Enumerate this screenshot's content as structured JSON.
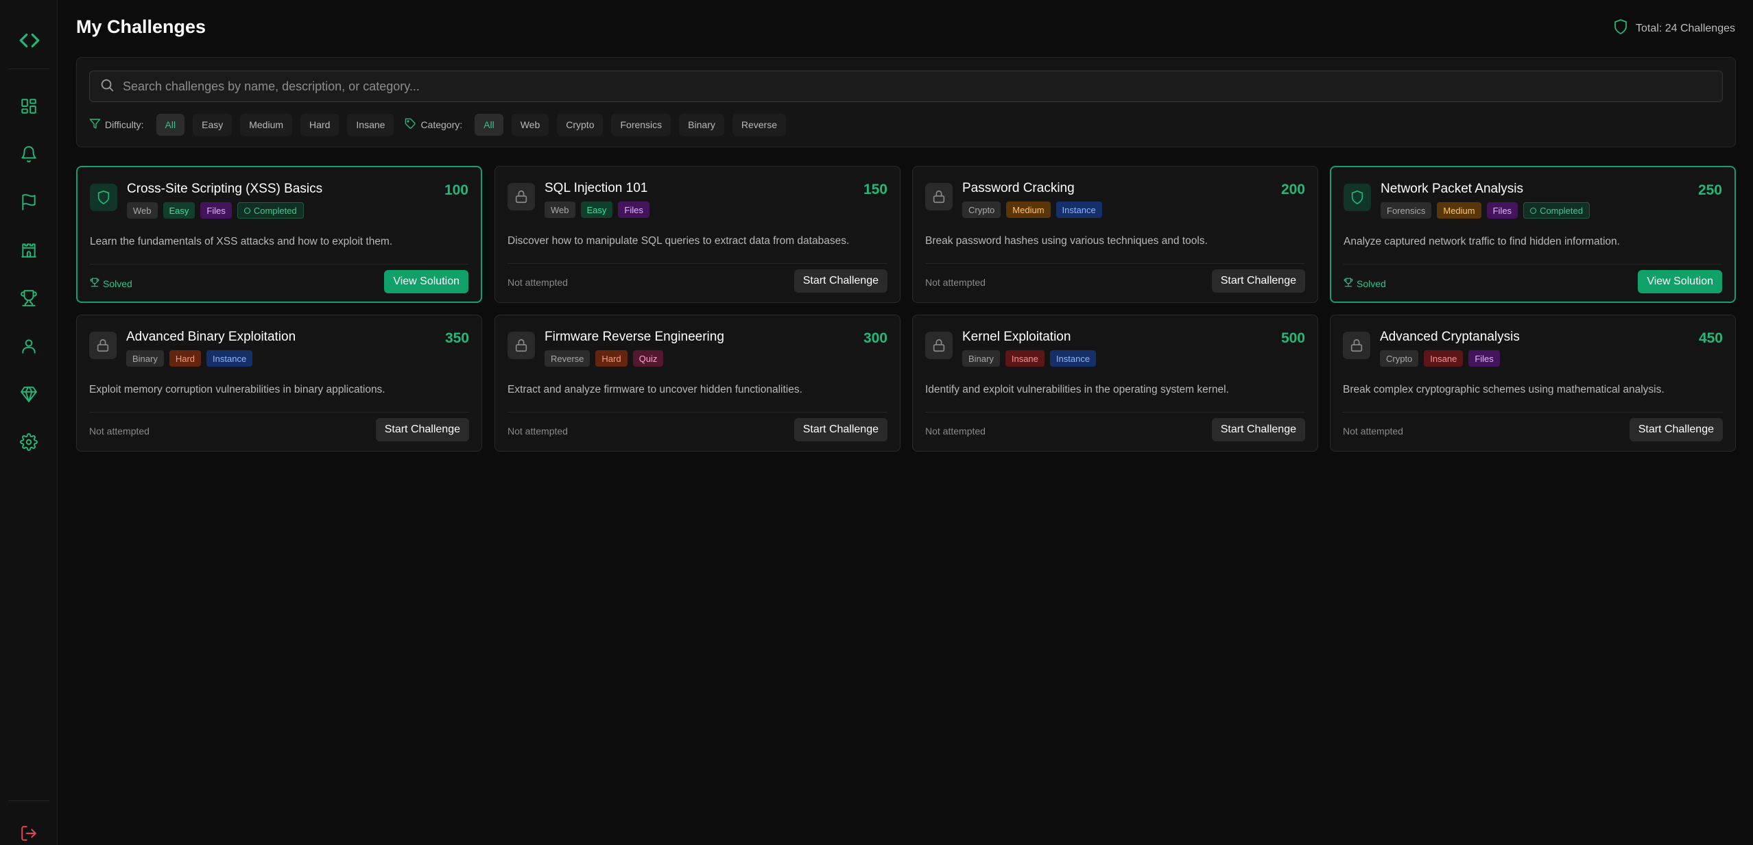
{
  "header": {
    "title": "My Challenges",
    "total": "Total: 24 Challenges"
  },
  "sidebar": {
    "icons": [
      "dashboard-icon",
      "bell-icon",
      "flag-icon",
      "castle-icon",
      "trophy-icon",
      "user-icon",
      "diamond-icon",
      "gear-icon"
    ],
    "logout": "logout-icon"
  },
  "search": {
    "placeholder": "Search challenges by name, description, or category..."
  },
  "filters": {
    "difficulty_label": "Difficulty:",
    "difficulty": [
      "All",
      "Easy",
      "Medium",
      "Hard",
      "Insane"
    ],
    "difficulty_selected": "All",
    "category_label": "Category:",
    "category": [
      "All",
      "Web",
      "Crypto",
      "Forensics",
      "Binary",
      "Reverse"
    ],
    "category_selected": "All"
  },
  "cards": [
    {
      "title": "Cross-Site Scripting (XSS) Basics",
      "points": "100",
      "category": "Web",
      "difficulty": "Easy",
      "type": "Files",
      "completed": "Completed",
      "description": "Learn the fundamentals of XSS attacks and how to exploit them.",
      "status": "Solved",
      "button": "View Solution"
    },
    {
      "title": "SQL Injection 101",
      "points": "150",
      "category": "Web",
      "difficulty": "Easy",
      "type": "Files",
      "description": "Discover how to manipulate SQL queries to extract data from databases.",
      "status": "Not attempted",
      "button": "Start Challenge"
    },
    {
      "title": "Password Cracking",
      "points": "200",
      "category": "Crypto",
      "difficulty": "Medium",
      "type": "Instance",
      "description": "Break password hashes using various techniques and tools.",
      "status": "Not attempted",
      "button": "Start Challenge"
    },
    {
      "title": "Network Packet Analysis",
      "points": "250",
      "category": "Forensics",
      "difficulty": "Medium",
      "type": "Files",
      "completed": "Completed",
      "description": "Analyze captured network traffic to find hidden information.",
      "status": "Solved",
      "button": "View Solution"
    },
    {
      "title": "Advanced Binary Exploitation",
      "points": "350",
      "category": "Binary",
      "difficulty": "Hard",
      "type": "Instance",
      "description": "Exploit memory corruption vulnerabilities in binary applications.",
      "status": "Not attempted",
      "button": "Start Challenge"
    },
    {
      "title": "Firmware Reverse Engineering",
      "points": "300",
      "category": "Reverse",
      "difficulty": "Hard",
      "type": "Quiz",
      "description": "Extract and analyze firmware to uncover hidden functionalities.",
      "status": "Not attempted",
      "button": "Start Challenge"
    },
    {
      "title": "Kernel Exploitation",
      "points": "500",
      "category": "Binary",
      "difficulty": "Insane",
      "type": "Instance",
      "description": "Identify and exploit vulnerabilities in the operating system kernel.",
      "status": "Not attempted",
      "button": "Start Challenge"
    },
    {
      "title": "Advanced Cryptanalysis",
      "points": "450",
      "category": "Crypto",
      "difficulty": "Insane",
      "type": "Files",
      "description": "Break complex cryptographic schemes using mathematical analysis.",
      "status": "Not attempted",
      "button": "Start Challenge"
    }
  ],
  "colors": {
    "accent": "#22b877",
    "background": "#0c0c0c",
    "logout": "#e5484d"
  }
}
